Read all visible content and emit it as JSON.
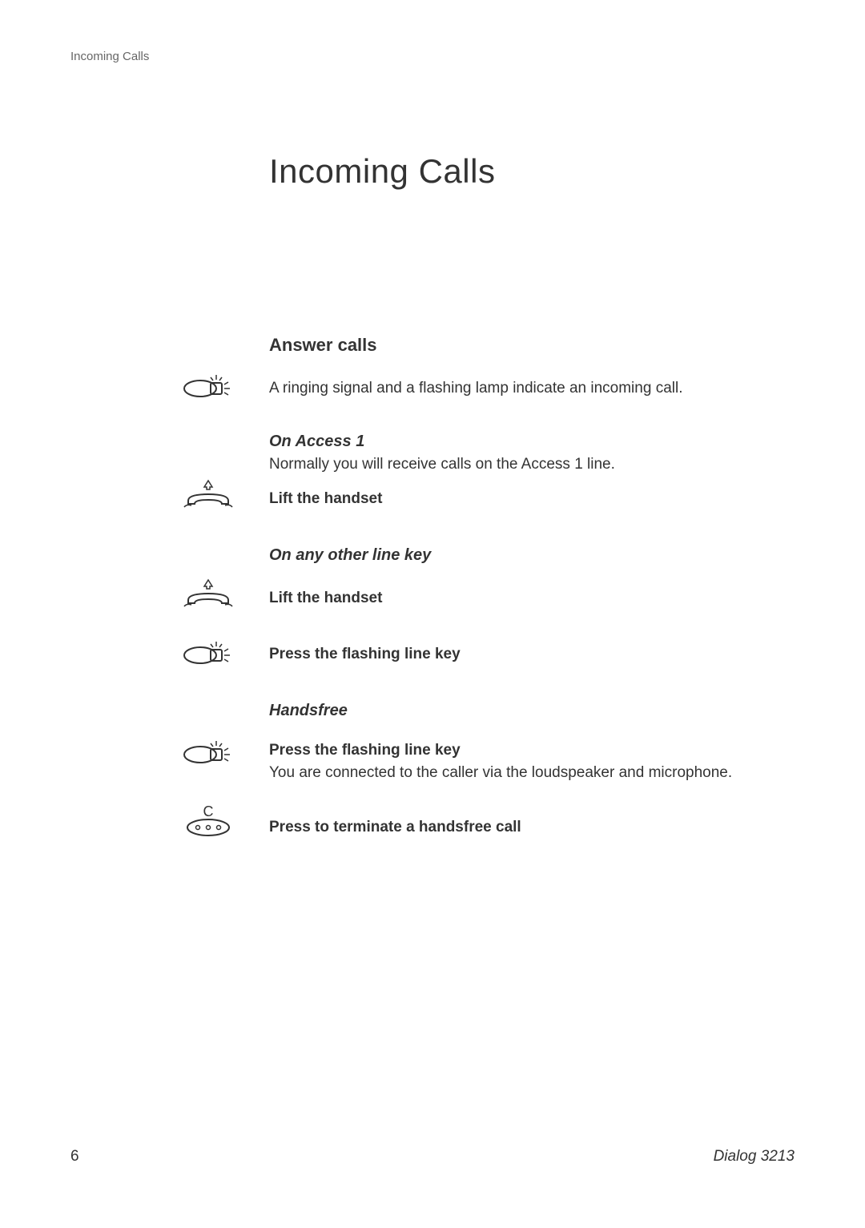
{
  "header": {
    "breadcrumb": "Incoming Calls"
  },
  "title": "Incoming Calls",
  "section": {
    "heading": "Answer calls",
    "intro": "A ringing signal and a flashing lamp indicate an incoming call.",
    "access1": {
      "subheading": "On Access 1",
      "text": "Normally you will receive calls on the Access 1 line.",
      "action": "Lift the handset"
    },
    "otherLine": {
      "subheading": "On any other line key",
      "action1": "Lift the handset",
      "action2": "Press the flashing line key"
    },
    "handsfree": {
      "subheading": "Handsfree",
      "action1": "Press the flashing line key",
      "text": "You are connected to the caller via the loudspeaker and microphone.",
      "action2": "Press to terminate a handsfree call"
    }
  },
  "footer": {
    "pageNumber": "6",
    "model": "Dialog 3213"
  },
  "icons": {
    "clearKeyLabel": "C"
  }
}
